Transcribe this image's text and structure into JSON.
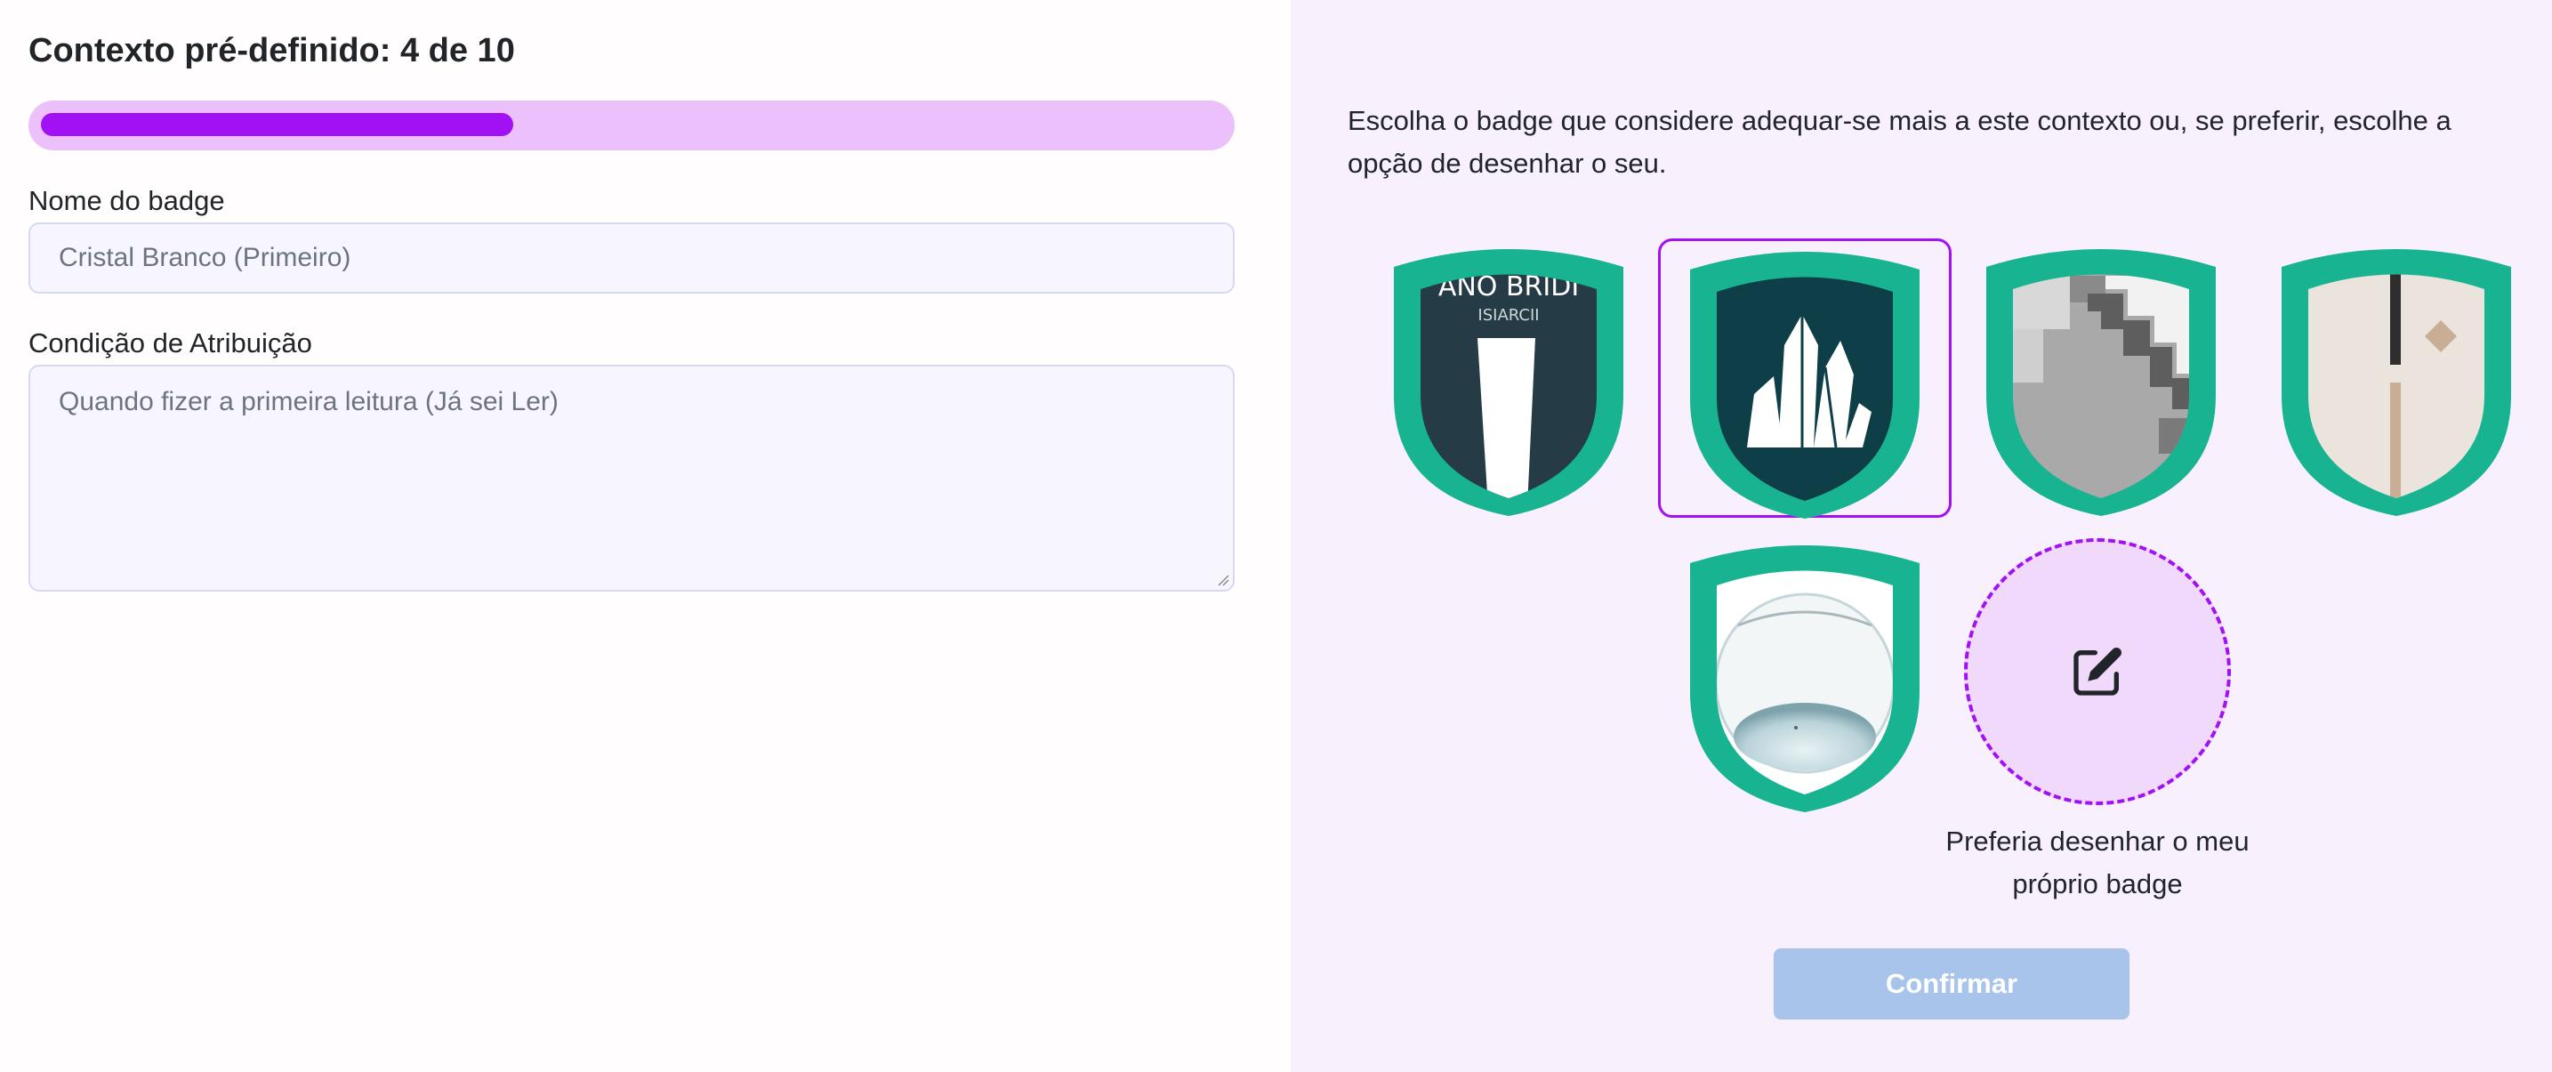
{
  "header": {
    "title": "Contexto pré-definido: 4 de 10"
  },
  "progress": {
    "current": 4,
    "total": 10,
    "fraction": 0.4
  },
  "form": {
    "name_label": "Nome do badge",
    "name_value": "Cristal Branco (Primeiro)",
    "condition_label": "Condição de Atribuição",
    "condition_value": "Quando fizer a primeira leitura (Já sei Ler)"
  },
  "chooser": {
    "intro": "Escolha o badge que considere adequar-se mais a este contexto ou, se preferir, escolhe a opção de desenhar o seu.",
    "badges": [
      {
        "id": "badge-1",
        "icon": "white-column-icon",
        "text_top": "ANO   BRIDI",
        "text_sub": "ISIARCII",
        "selected": false
      },
      {
        "id": "badge-2",
        "icon": "white-crystal-icon",
        "selected": true
      },
      {
        "id": "badge-3",
        "icon": "pixel-stairs-icon",
        "selected": false
      },
      {
        "id": "badge-4",
        "icon": "beige-abstract-icon",
        "selected": false
      },
      {
        "id": "badge-5",
        "icon": "glass-bowl-icon",
        "selected": false
      }
    ],
    "draw_option": {
      "label": "Preferia desenhar o meu próprio badge",
      "icon": "edit-pencil-icon"
    },
    "confirm_label": "Confirmar"
  },
  "colors": {
    "accent": "#a210f4",
    "progress_track": "#ebc0fb",
    "badge_border": "#18b390",
    "confirm_disabled": "#a8c4ea",
    "panel_bg": "#f9f0fd"
  }
}
